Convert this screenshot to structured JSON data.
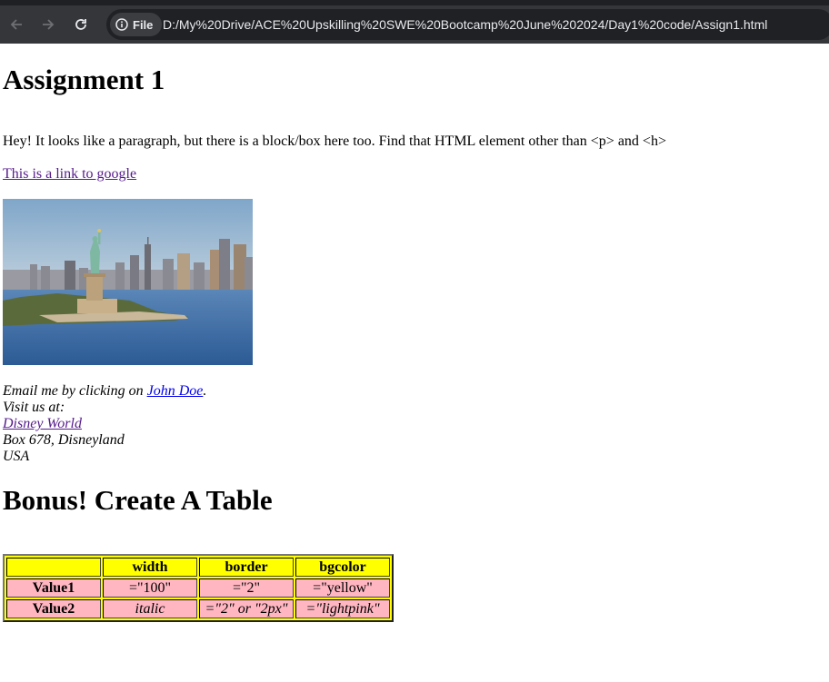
{
  "browser": {
    "chip_label": "File",
    "url": "D:/My%20Drive/ACE%20Upskilling%20SWE%20Bootcamp%20June%202024/Day1%20code/Assign1.html"
  },
  "content": {
    "title": "Assignment 1",
    "paragraph": "Hey! It looks like a paragraph, but there is a block/box here too. Find that HTML element other than <p> and <h>",
    "google_link": "This is a link to google",
    "address": {
      "email_prefix": "Email me by clicking on ",
      "email_link": "John Doe",
      "email_suffix": ".",
      "visit": "Visit us at:",
      "disney_link": "Disney World",
      "box": "Box 678, Disneyland",
      "country": "USA"
    },
    "bonus_title": "Bonus! Create A Table",
    "table": {
      "headers": [
        "",
        "width",
        "border",
        "bgcolor"
      ],
      "rows": [
        {
          "label": "Value1",
          "cells": [
            "=\"100\"",
            "=\"2\"",
            "=\"yellow\""
          ]
        },
        {
          "label": "Value2",
          "cells": [
            "italic",
            "=\"2\" or \"2px\"",
            "=\"lightpink\""
          ]
        }
      ]
    }
  },
  "colors": {
    "table_bg": "#ffff00",
    "row_bg": "#ffb6c1",
    "visited_link": "#551a8b",
    "unvisited_link": "#0000ee"
  }
}
